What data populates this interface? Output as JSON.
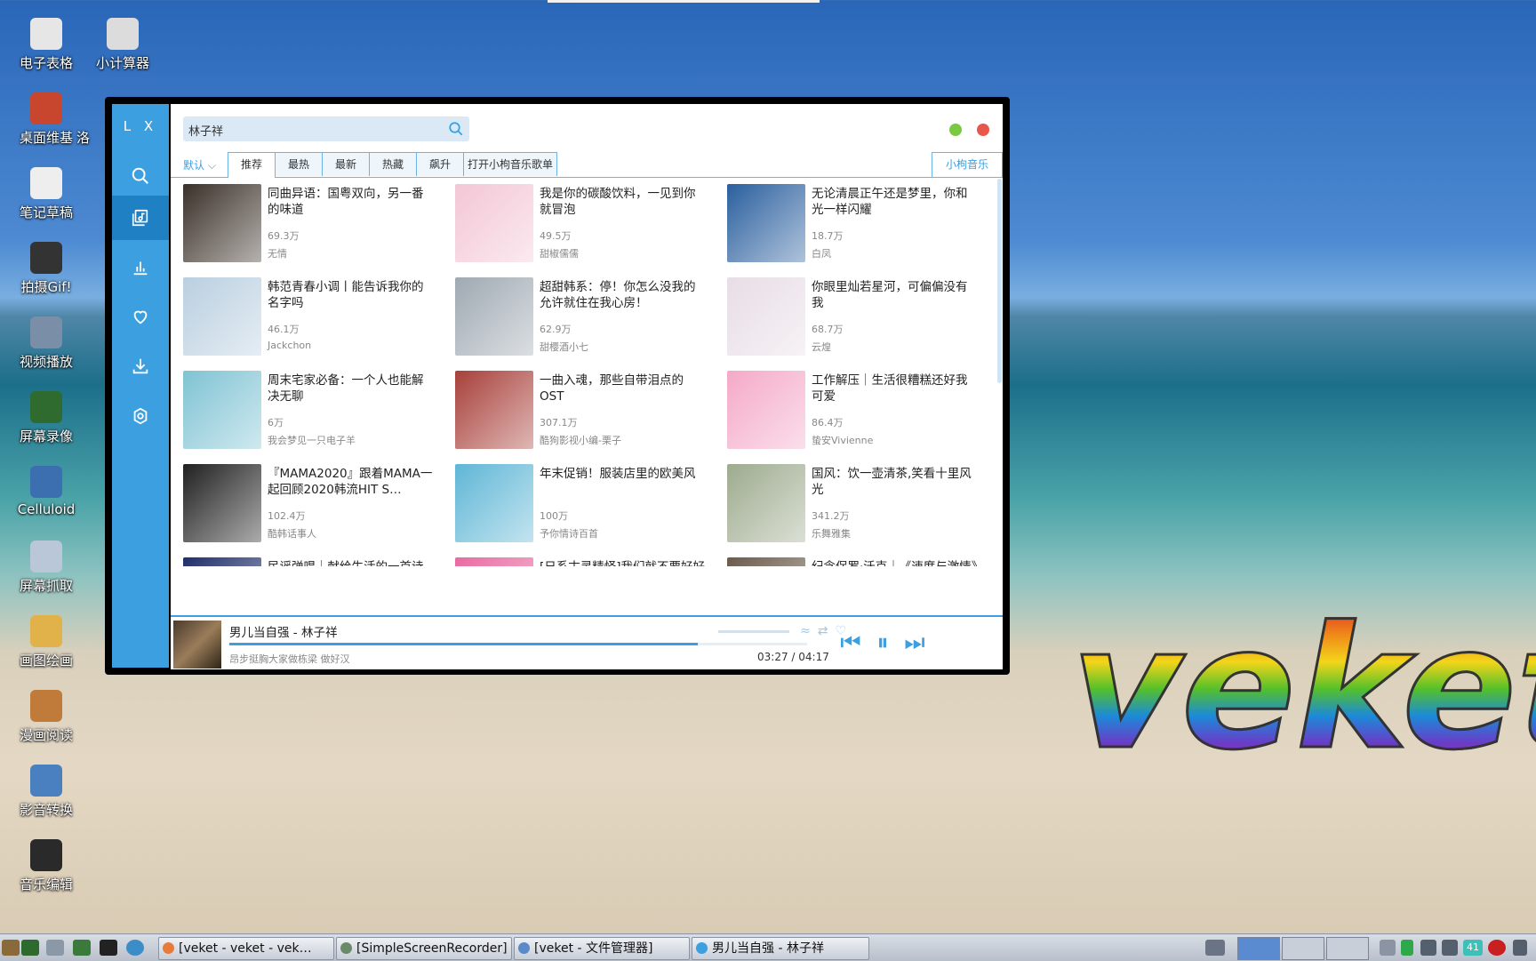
{
  "desktop": {
    "icons": [
      {
        "label": "电子表格",
        "color": "#e6e6e6"
      },
      {
        "label": "小计算器",
        "color": "#dcdcdc"
      },
      {
        "label": "桌面维基",
        "color": "#c8462e"
      },
      {
        "label": "洛",
        "color": "#00000000"
      },
      {
        "label": "笔记草稿",
        "color": "#eeeeee"
      },
      {
        "label": "拍摄Gif!",
        "color": "#333333"
      },
      {
        "label": "视频播放",
        "color": "#7b8ea8"
      },
      {
        "label": "屏幕录像",
        "color": "#2f6b2f"
      },
      {
        "label": "Celluloid",
        "color": "#3c6fb0"
      },
      {
        "label": "屏幕抓取",
        "color": "#b9c7d8"
      },
      {
        "label": "画图绘画",
        "color": "#e2b24a"
      },
      {
        "label": "漫画阅读",
        "color": "#c07a3a"
      },
      {
        "label": "影音转换",
        "color": "#4a7fc0"
      },
      {
        "label": "音乐编辑",
        "color": "#2a2a2a"
      }
    ],
    "brand_text": "veket"
  },
  "app": {
    "logo": "L X",
    "search": {
      "value": "林子祥"
    },
    "tabs": {
      "sort_label": "默认",
      "items": [
        "推荐",
        "最热",
        "最新",
        "热藏",
        "飙升",
        "打开小枸音乐歌单"
      ],
      "source": "小枸音乐"
    },
    "playlists": [
      {
        "title": "同曲异语：国粤双向，另一番的味道",
        "plays": "69.3万",
        "author": "无情",
        "cover": "#3a3028"
      },
      {
        "title": "我是你的碳酸饮料，一见到你就冒泡",
        "plays": "49.5万",
        "author": "甜椒儒儒",
        "cover": "#f3c6d6"
      },
      {
        "title": "无论清晨正午还是梦里，你和光一样闪耀",
        "plays": "18.7万",
        "author": "白凤",
        "cover": "#2a5f9e"
      },
      {
        "title": "韩范青春小调丨能告诉我你的名字吗",
        "plays": "46.1万",
        "author": "Jackchon",
        "cover": "#b9cfe0"
      },
      {
        "title": "超甜韩系：停！你怎么没我的允许就住在我心房！",
        "plays": "62.9万",
        "author": "甜樱酒小七",
        "cover": "#9fa9b2"
      },
      {
        "title": "你眼里灿若星河，可偏偏没有我",
        "plays": "68.7万",
        "author": "云煌",
        "cover": "#e8dde6"
      },
      {
        "title": "周末宅家必备：一个人也能解决无聊",
        "plays": "6万",
        "author": "我会梦见一只电子羊",
        "cover": "#7fc3d3"
      },
      {
        "title": "一曲入魂，那些自带泪点的OST",
        "plays": "307.1万",
        "author": "酷狗影视小编-栗子",
        "cover": "#a8403a"
      },
      {
        "title": "工作解压｜生活很糟糕还好我可爱",
        "plays": "86.4万",
        "author": "蛰安Vivienne",
        "cover": "#f4a9c8"
      },
      {
        "title": "『MAMA2020』跟着MAMA一起回顾2020韩流HIT S…",
        "plays": "102.4万",
        "author": "酷韩话事人",
        "cover": "#202020"
      },
      {
        "title": "年末促销！服装店里的欧美风",
        "plays": "100万",
        "author": "予你情诗百首",
        "cover": "#5fb6d6"
      },
      {
        "title": "国风：饮一壶清茶,笑看十里风光",
        "plays": "341.2万",
        "author": "乐舞雅集",
        "cover": "#9eab8e"
      },
      {
        "title": "民谣弹唱｜献给生活的一首诗",
        "plays": "",
        "author": "",
        "cover": "#1e2e6a"
      },
      {
        "title": "[日系古灵精怪]我们就不要好好唱歌",
        "plays": "",
        "author": "",
        "cover": "#e86aa0"
      },
      {
        "title": "纪念保罗·沃克｜《速度与激情》系列配乐精选",
        "plays": "",
        "author": "",
        "cover": "#6a5a4a"
      }
    ],
    "player": {
      "title": "男儿当自强 - 林子祥",
      "lyric": "昂步挺胸大家做栋梁 做好汉",
      "time": "03:27 / 04:17",
      "progress": 0.81
    }
  },
  "taskbar": {
    "tasks": [
      {
        "label": "[veket - veket - vek…",
        "color": "#e87a3a"
      },
      {
        "label": "[SimpleScreenRecorder]",
        "color": "#6a8a6a"
      },
      {
        "label": "[veket - 文件管理器]",
        "color": "#5a8ac8"
      },
      {
        "label": "男儿当自强 - 林子祥",
        "color": "#3b9fe0"
      }
    ],
    "tray_badge": "41"
  }
}
